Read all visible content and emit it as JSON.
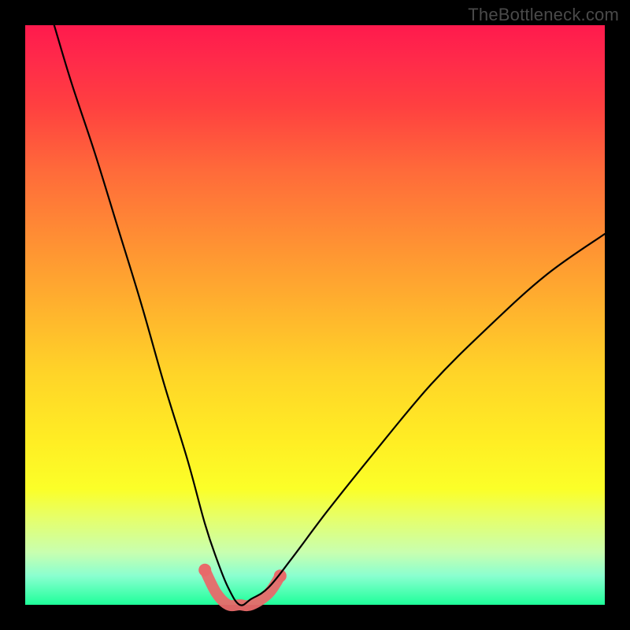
{
  "watermark": {
    "text": "TheBottleneck.com"
  },
  "chart_data": {
    "type": "line",
    "title": "",
    "xlabel": "",
    "ylabel": "",
    "xlim": [
      0,
      100
    ],
    "ylim": [
      0,
      100
    ],
    "grid": false,
    "legend": false,
    "background": "rainbow-vertical-gradient (red top → green bottom) indicating bottleneck severity",
    "series": [
      {
        "name": "bottleneck-curve",
        "note": "V-shaped curve; y ≈ bottleneck % (0 best, 100 worst); minimum near x≈37",
        "x": [
          5,
          8,
          12,
          16,
          20,
          24,
          28,
          31,
          33,
          35,
          37,
          39,
          42,
          46,
          52,
          60,
          70,
          80,
          90,
          100
        ],
        "y": [
          100,
          90,
          78,
          65,
          52,
          38,
          25,
          14,
          8,
          3,
          0,
          1,
          3,
          8,
          16,
          26,
          38,
          48,
          57,
          64
        ]
      },
      {
        "name": "optimal-band-highlight",
        "note": "salmon-highlighted flat valley near minimum (optimal pairing region)",
        "x": [
          31,
          33,
          35,
          37,
          39,
          42,
          44
        ],
        "y": [
          6,
          2,
          0,
          0,
          0,
          2,
          5
        ]
      }
    ]
  }
}
